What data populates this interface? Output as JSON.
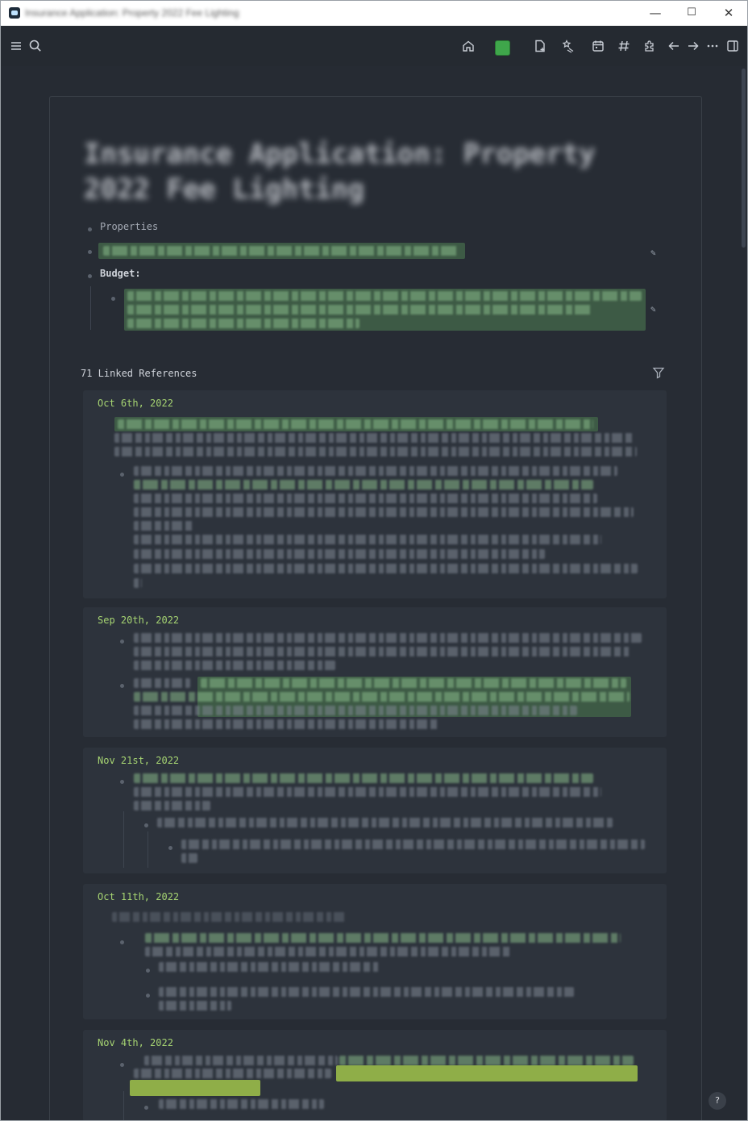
{
  "window": {
    "title": "Insurance Application: Property 2022 Fee Lighting",
    "controls": {
      "minimize": "—",
      "maximize": "☐",
      "close": "✕"
    }
  },
  "toolbar": {
    "icons": [
      "menu-icon",
      "search-icon",
      "home-icon",
      "graph-icon",
      "new-page-icon",
      "favorites-icon",
      "calendar-icon",
      "tag-icon",
      "plugin-icon",
      "back-icon",
      "forward-icon",
      "more-icon",
      "sidebar-icon"
    ]
  },
  "page": {
    "title": "Insurance Application: Property 2022 Fee Lighting",
    "properties_label": "Properties",
    "property_value": "PROP Fee 2022 Rate Schedule Contract Insured Amount Reference",
    "budget_label": "Budget:",
    "budget_value": "Estimated budget line item for insurance property lighting fee reference amount estimated total"
  },
  "linked": {
    "header": "71 Linked References"
  },
  "references": [
    {
      "date": "Oct 6th, 2022"
    },
    {
      "date": "Sep 20th, 2022"
    },
    {
      "date": "Nov 21st, 2022"
    },
    {
      "date": "Oct 11th, 2022"
    },
    {
      "date": "Nov 4th, 2022"
    }
  ],
  "help": {
    "label": "?"
  },
  "colors": {
    "accent": "#a6d472",
    "graph": "#3fa64b",
    "background": "#262b33"
  }
}
